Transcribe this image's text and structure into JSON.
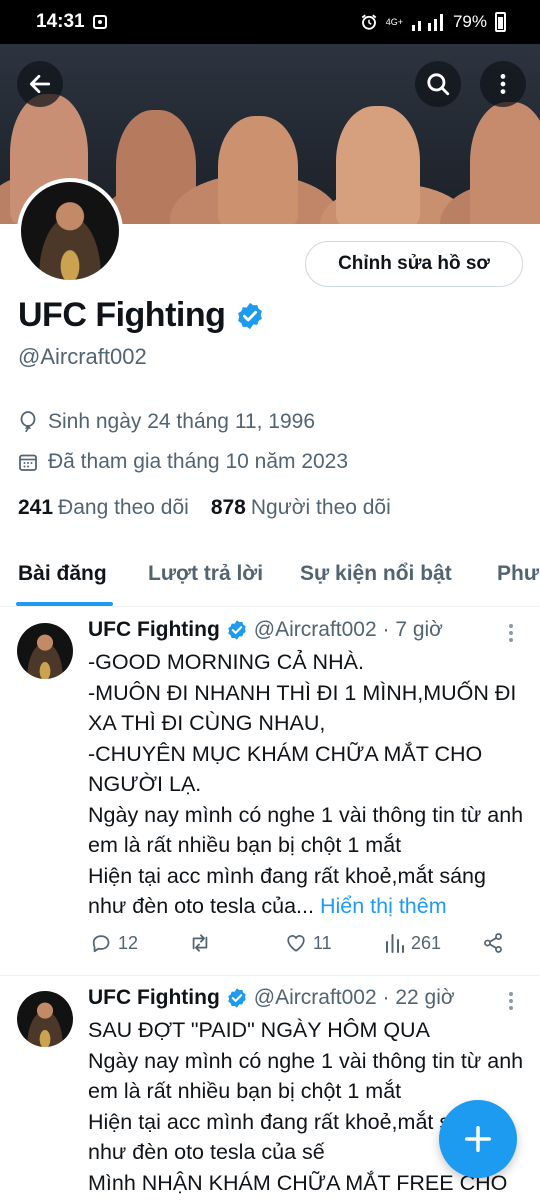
{
  "status_bar": {
    "time": "14:31",
    "network": "4G+",
    "battery": "79%"
  },
  "profile": {
    "name": "UFC Fighting",
    "handle": "@Aircraft002",
    "edit_button": "Chỉnh sửa hồ sơ",
    "birthday": "Sinh ngày 24 tháng 11, 1996",
    "joined": "Đã tham gia tháng 10 năm 2023",
    "following_count": "241",
    "following_label": "Đang theo dõi",
    "followers_count": "878",
    "followers_label": "Người theo dõi"
  },
  "tabs": [
    "Bài đăng",
    "Lượt trả lời",
    "Sự kiện nổi bật",
    "Phư"
  ],
  "posts": [
    {
      "name": "UFC Fighting",
      "meta": "@Aircraft002 · 7 giờ",
      "text": "-GOOD MORNING CẢ NHÀ.\n-MUÔN ĐI NHANH THÌ ĐI 1 MÌNH,MUỐN ĐI XA THÌ ĐI CÙNG NHAU,\n-CHUYÊN MỤC KHÁM CHỮA MẮT CHO NGƯỜI LẠ.\nNgày nay mình có nghe 1 vài thông tin từ anh em là rất nhiều bạn bị chột 1 mắt\nHiện tại acc mình đang rất khoẻ,mắt sáng như đèn oto tesla của...",
      "show_more": "Hiển thị thêm",
      "replies": "12",
      "likes": "11",
      "views": "261"
    },
    {
      "name": "UFC Fighting",
      "meta": "@Aircraft002 · 22 giờ",
      "text": "SAU ĐỢT \"PAID\" NGÀY HÔM QUA\nNgày nay mình có nghe 1 vài thông tin từ anh em là rất nhiều bạn bị chột 1 mắt\nHiện tại acc mình đang rất khoẻ,mắt sáng như đèn oto tesla của sế\nMình NHẬN KHÁM CHỮA MẮT FREE CHO"
    }
  ],
  "colors": {
    "accent": "#1d9bf0",
    "secondary_text": "#536471",
    "verified": "#1d9bf0"
  }
}
